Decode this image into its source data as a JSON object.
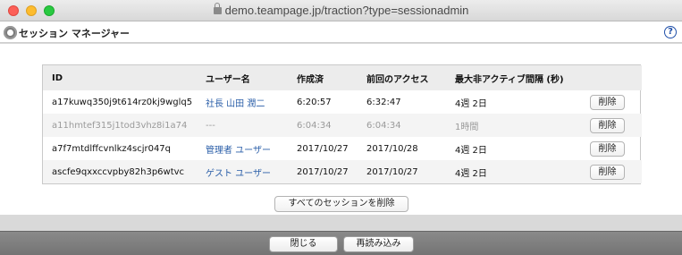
{
  "window": {
    "url": "demo.teampage.jp/traction?type=sessionadmin"
  },
  "header": {
    "title": "セッション マネージャー",
    "help_label": "?"
  },
  "table": {
    "columns": [
      "ID",
      "ユーザー名",
      "作成済",
      "前回のアクセス",
      "最大非アクティブ間隔 (秒)",
      ""
    ],
    "rows": [
      {
        "id": "a17kuwq350j9t614rz0kj9wglq5",
        "user": "社長 山田 潤二",
        "created": "6:20:57",
        "last_access": "6:32:47",
        "max_inactive": "4週 2日",
        "action": "削除"
      },
      {
        "id": "a11hmtef315j1tod3vhz8i1a74",
        "user": "---",
        "created": "6:04:34",
        "last_access": "6:04:34",
        "max_inactive": "1時間",
        "action": "削除"
      },
      {
        "id": "a7f7mtdlffcvnlkz4scjr047q",
        "user": "管理者 ユーザー",
        "created": "2017/10/27",
        "last_access": "2017/10/28",
        "max_inactive": "4週 2日",
        "action": "削除"
      },
      {
        "id": "ascfe9qxxccvpby82h3p6wtvc",
        "user": "ゲスト ユーザー",
        "created": "2017/10/27",
        "last_access": "2017/10/27",
        "max_inactive": "4週 2日",
        "action": "削除"
      }
    ]
  },
  "delete_all_label": "すべてのセッションを削除",
  "footer": {
    "close_label": "閉じる",
    "reload_label": "再読み込み"
  },
  "colors": {
    "link": "#2a5ea8",
    "inactive_text": "#9a9a9a"
  }
}
